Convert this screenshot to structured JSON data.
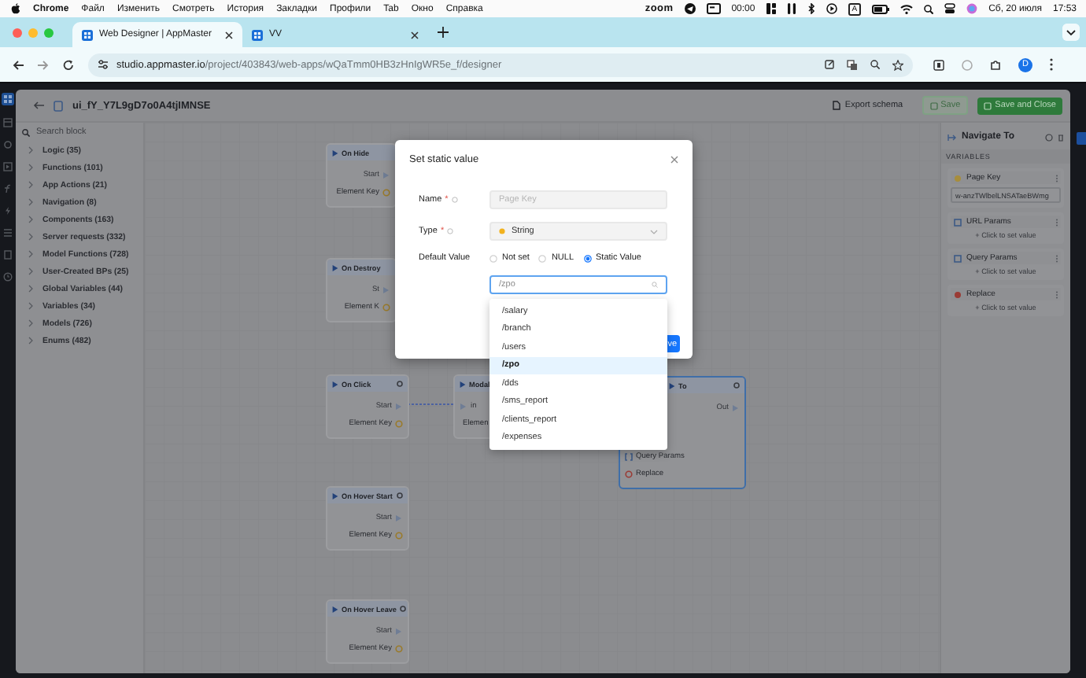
{
  "menu_bar": {
    "app_name": "Chrome",
    "items": [
      "Файл",
      "Изменить",
      "Смотреть",
      "История",
      "Закладки",
      "Профили",
      "Tab",
      "Окно",
      "Справка"
    ],
    "status": {
      "zoom": "zoom",
      "timer": "00:00",
      "input_source": "A",
      "date": "Сб, 20 июля",
      "time": "17:53"
    }
  },
  "browser": {
    "tabs": [
      {
        "title": "Web Designer | AppMaster",
        "selected": true
      },
      {
        "title": "VV",
        "selected": false
      }
    ],
    "url_host": "studio.appmaster.io",
    "url_path": "/project/403843/web-apps/wQaTmm0HB3zHnIgWR5e_f/designer",
    "profile": "D"
  },
  "app": {
    "title": "ui_fY_Y7L9gD7o0A4tjIMNSE",
    "export": "Export schema",
    "save": "Save",
    "save_close": "Save and Close"
  },
  "sidebar": {
    "search_placeholder": "Search block",
    "categories": [
      "Logic (35)",
      "Functions (101)",
      "App Actions (21)",
      "Navigation (8)",
      "Components (163)",
      "Server requests (332)",
      "Model Functions (728)",
      "User-Created BPs (25)",
      "Global Variables (44)",
      "Variables (34)",
      "Models (726)",
      "Enums (482)"
    ]
  },
  "canvas": {
    "nodes": [
      {
        "title": "On Hide",
        "selected": false,
        "ports": [
          {
            "label": "Start",
            "kind": "exec_out"
          },
          {
            "label": "Element Key",
            "kind": "value_out"
          }
        ]
      },
      {
        "title": "On Destroy",
        "selected": false,
        "ports": [
          {
            "label": "St",
            "kind": "exec_out"
          },
          {
            "label": "Element K",
            "kind": "value_out"
          }
        ]
      },
      {
        "title": "On Click",
        "selected": false,
        "ports": [
          {
            "label": "Start",
            "kind": "exec_out"
          },
          {
            "label": "Element Key",
            "kind": "value_out"
          }
        ]
      },
      {
        "title": "On Hover Start",
        "selected": false,
        "ports": [
          {
            "label": "Start",
            "kind": "exec_out"
          },
          {
            "label": "Element Key",
            "kind": "value_out"
          }
        ]
      },
      {
        "title": "On Hover Leave",
        "selected": false,
        "ports": [
          {
            "label": "Start",
            "kind": "exec_out"
          },
          {
            "label": "Element Key",
            "kind": "value_out"
          }
        ]
      },
      {
        "title": "Modal",
        "selected": false,
        "ports": [
          {
            "label": "in",
            "kind": "exec_in"
          },
          {
            "label": "Elemen",
            "kind": "value_in"
          }
        ]
      },
      {
        "title": "To",
        "selected": true,
        "ports": [
          {
            "label": "Out",
            "kind": "exec_out"
          },
          {
            "label": "Query Params",
            "kind": "object_in"
          },
          {
            "label": "Replace",
            "kind": "bool_in"
          }
        ]
      }
    ]
  },
  "properties": {
    "title": "Navigate To",
    "section": "VARIABLES",
    "variables": [
      {
        "name": "Page Key",
        "kind": "string",
        "value": "w-anzTWlbelLNSATaeBWmg"
      },
      {
        "name": "URL Params",
        "kind": "object",
        "action": "+ Click to set value"
      },
      {
        "name": "Query Params",
        "kind": "object",
        "action": "+ Click to set value"
      },
      {
        "name": "Replace",
        "kind": "bool",
        "action": "+ Click to set value"
      }
    ]
  },
  "dialog": {
    "title": "Set static value",
    "fields": [
      {
        "label": "Name",
        "mark": "*",
        "kind": "text",
        "value": "Page Key",
        "disabled": true
      },
      {
        "label": "Type",
        "mark": "*",
        "kind": "select",
        "value": "String"
      }
    ],
    "default_value": {
      "label": "Default Value",
      "options": [
        {
          "label": "Not set",
          "selected": false
        },
        {
          "label": "NULL",
          "selected": false
        },
        {
          "label": "Static Value",
          "selected": true
        }
      ]
    },
    "search": {
      "placeholder": "/zpo"
    },
    "footer_button": "ve"
  },
  "dropdown": {
    "options": [
      {
        "label": "/salary",
        "selected": false
      },
      {
        "label": "/branch",
        "selected": false
      },
      {
        "label": "/users",
        "selected": false
      },
      {
        "label": "/zpo",
        "selected": true
      },
      {
        "label": "/dds",
        "selected": false
      },
      {
        "label": "/sms_report",
        "selected": false
      },
      {
        "label": "/clients_report",
        "selected": false
      },
      {
        "label": "/expenses",
        "selected": false
      }
    ]
  }
}
